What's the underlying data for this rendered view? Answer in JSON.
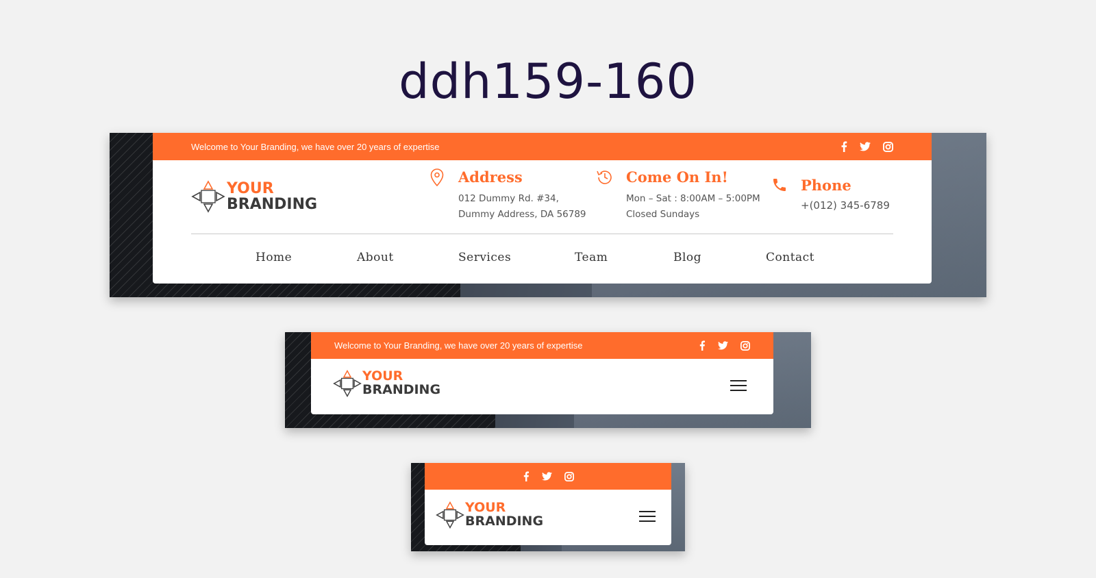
{
  "page_title": "ddh159-160",
  "colors": {
    "accent": "#ff6c2c",
    "title": "#1e1340",
    "text": "#555555"
  },
  "header_large": {
    "welcome_text": "Welcome to Your Branding, we have over 20 years of expertise",
    "social": [
      "facebook-icon",
      "twitter-icon",
      "instagram-icon"
    ],
    "logo": {
      "line1": "YOUR",
      "line2": "BRANDING"
    },
    "address": {
      "title": "Address",
      "line1": "012 Dummy Rd. #34,",
      "line2": "Dummy Address, DA 56789"
    },
    "hours": {
      "title": "Come On In!",
      "line1": "Mon – Sat : 8:00AM – 5:00PM",
      "line2": "Closed Sundays"
    },
    "phone": {
      "title": "Phone",
      "line1": "+(012) 345-6789"
    },
    "nav": [
      "Home",
      "About",
      "Services",
      "Team",
      "Blog",
      "Contact"
    ]
  },
  "header_medium": {
    "welcome_text": "Welcome to Your Branding, we have over 20 years of expertise",
    "logo": {
      "line1": "YOUR",
      "line2": "BRANDING"
    }
  },
  "header_small": {
    "logo": {
      "line1": "YOUR",
      "line2": "BRANDING"
    }
  }
}
